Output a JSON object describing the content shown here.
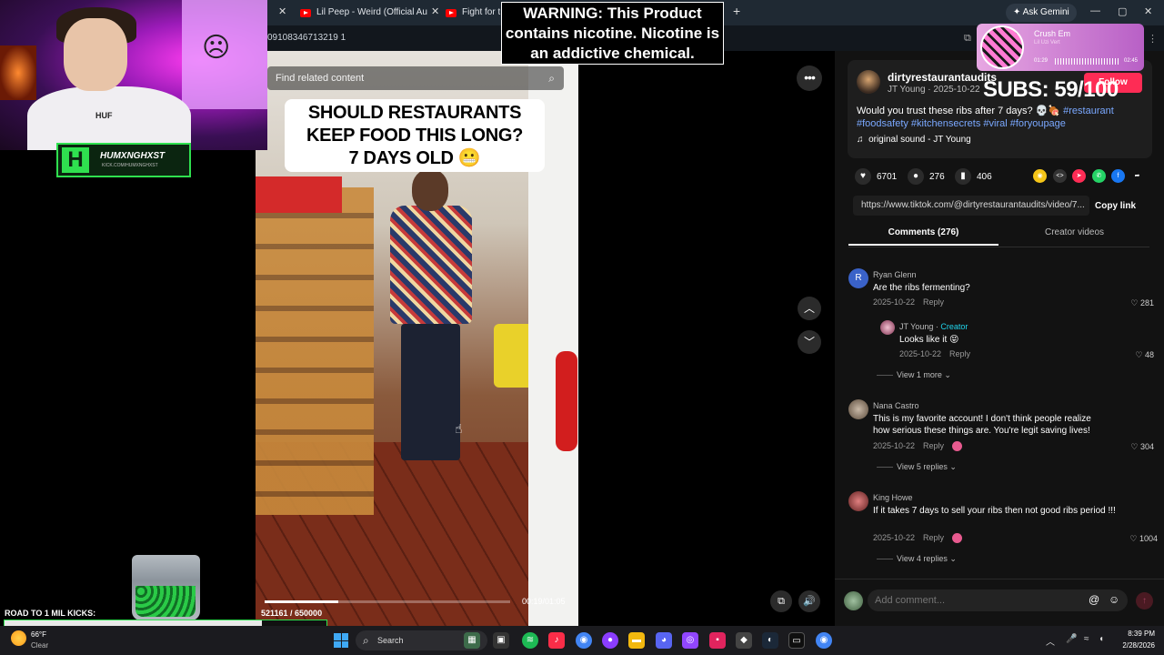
{
  "browser": {
    "tabs": [
      {
        "label": "Lil Peep - Weird (Official Audio)"
      },
      {
        "label": "Fight for the"
      }
    ],
    "ask_gemini": "Ask Gemini",
    "url": "09108346713219 1"
  },
  "overlay": {
    "warning": "WARNING: This Product contains nicotine. Nicotine is an addictive chemical.",
    "streamer_name": "HUMXNGHXST",
    "streamer_sub": "KICK.COM/HUMXNGHXST",
    "shirt_logo": "HUF",
    "road_label": "ROAD TO 1 MIL KICKS:",
    "road_progress_fraction": 0.8,
    "subs": "SUBS: 59/100",
    "music": {
      "song": "Crush Em",
      "artist": "Lil Uzi Vert",
      "elapsed": "01:29",
      "duration": "02:45"
    }
  },
  "video": {
    "search_placeholder": "Find related content",
    "caption_line1": "SHOULD RESTAURANTS",
    "caption_line2": "KEEP FOOD THIS LONG?",
    "caption_line3": "7 DAYS OLD 😬",
    "counter": "521161  / 650000",
    "time": "00:19/01:05",
    "progress_fraction": 0.3
  },
  "post": {
    "author": "dirtyrestaurantaudits",
    "author_sub": "JT Young · 2025-10-22",
    "follow": "Follow",
    "desc_text": "Would you trust these ribs after 7 days? 💀🍖 ",
    "desc_tags": "#restaurant #foodsafety #kitchensecrets #viral #foryoupage",
    "sound": "original sound - JT Young",
    "likes": "6701",
    "comments": "276",
    "saves": "406",
    "link": "https://www.tiktok.com/@dirtyrestaurantaudits/video/7...",
    "copy_link": "Copy link",
    "tab_comments": "Comments (276)",
    "tab_creator": "Creator videos"
  },
  "comments": [
    {
      "name": "Ryan Glenn",
      "text": "Are the ribs fermenting?",
      "date": "2025-10-22",
      "reply": "Reply",
      "likes": "281",
      "avatar_letter": "R"
    },
    {
      "name": "JT Young · ",
      "creator": "Creator",
      "text": "Looks like it 😝",
      "date": "2025-10-22",
      "reply": "Reply",
      "likes": "48",
      "view_more": "View 1 more ⌄"
    },
    {
      "name": "Nana Castro",
      "text": "This is my favorite account! I don't think people realize how serious these things are. You're legit saving lives!",
      "date": "2025-10-22",
      "reply": "Reply",
      "likes": "304",
      "view_more": "View 5 replies ⌄"
    },
    {
      "name": "King Howe",
      "text": "If it takes 7 days to sell your ribs then not good ribs period !!!",
      "date": "2025-10-22",
      "reply": "Reply",
      "likes": "1004",
      "view_more": "View 4 replies ⌄"
    }
  ],
  "comment_input": {
    "placeholder": "Add comment..."
  },
  "taskbar": {
    "temp": "66°F",
    "condition": "Clear",
    "search": "Search",
    "time": "8:39 PM",
    "date": "2/28/2026"
  },
  "colors": {
    "accent": "#fe2c55",
    "hashtag": "#7aa8ff",
    "kick_green": "#2fe04f",
    "creator": "#20d5ec"
  }
}
